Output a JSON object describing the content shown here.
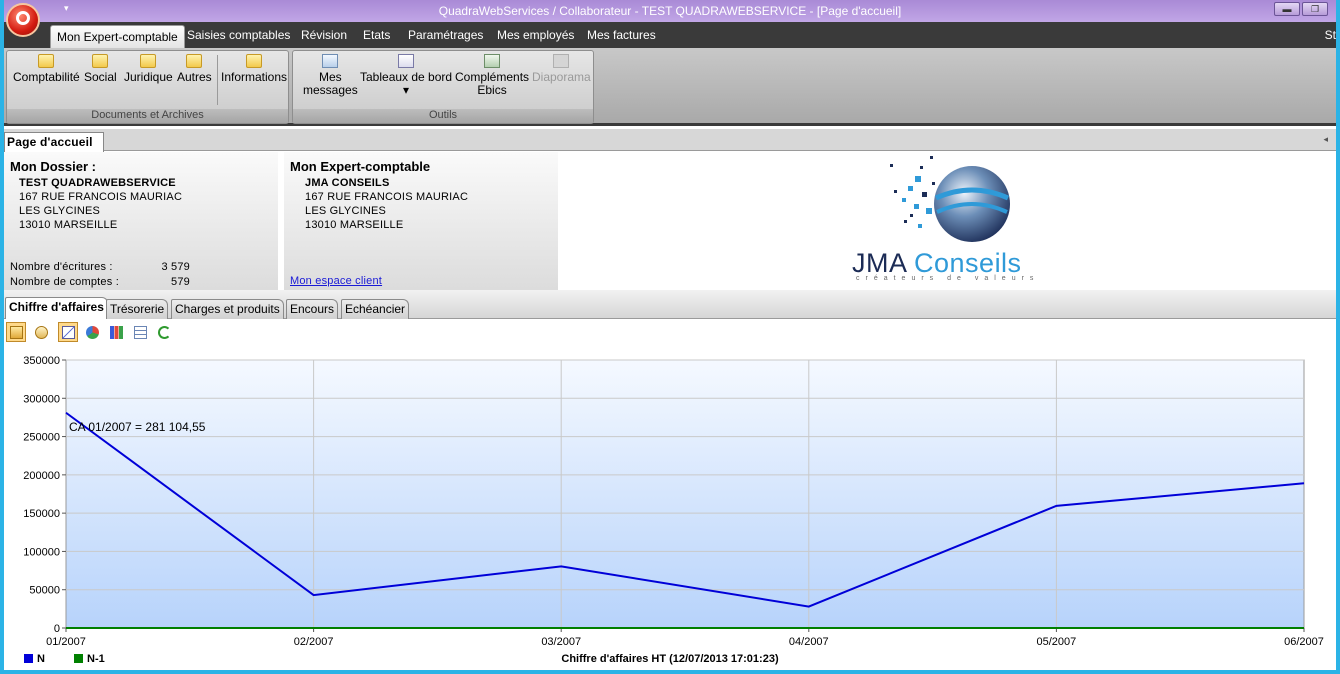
{
  "window": {
    "title": "QuadraWebServices / Collaborateur - TEST QUADRAWEBSERVICE - [Page d'accueil]",
    "minimize_label": "▬",
    "restore_label": "❐"
  },
  "qat_label": "▾",
  "menu": {
    "tabs": [
      "Mon Expert-comptable",
      "Saisies comptables",
      "Révision",
      "Etats",
      "Paramétrages",
      "Mes employés",
      "Mes factures"
    ],
    "active_index": 0,
    "overflow_label": "St"
  },
  "ribbon": {
    "documents_group": {
      "label": "Documents et Archives",
      "buttons": [
        "Comptabilité",
        "Social",
        "Juridique",
        "Autres",
        "Informations"
      ]
    },
    "outils_group": {
      "label": "Outils",
      "messages_line1": "Mes",
      "messages_line2": "messages",
      "tableaux_label": "Tableaux de bord",
      "tableaux_arrow": "▾",
      "complements_line1": "Compléments",
      "complements_line2": "Ebics",
      "diaporama_label": "Diaporama"
    }
  },
  "doc_tab": {
    "label": "Page d'accueil",
    "collapse_icon": "◂"
  },
  "mon_dossier": {
    "heading": "Mon Dossier :",
    "name": "TEST QUADRAWEBSERVICE",
    "address1": "167 RUE FRANCOIS MAURIAC",
    "address2": "LES GLYCINES",
    "city": "13010 MARSEILLE",
    "ecritures_label": "Nombre d'écritures :",
    "ecritures_value": "3 579",
    "comptes_label": "Nombre de comptes :",
    "comptes_value": "579"
  },
  "mon_expert": {
    "heading": "Mon Expert-comptable",
    "name": "JMA CONSEILS",
    "address1": "167 RUE FRANCOIS MAURIAC",
    "address2": "LES GLYCINES",
    "city": "13010 MARSEILLE",
    "link": "Mon espace client"
  },
  "logo": {
    "name_part1": "JMA ",
    "name_part2": "Conseils",
    "tagline": "créateurs de valeurs"
  },
  "sub_tabs": [
    "Chiffre d'affaires",
    "Trésorerie",
    "Charges et produits",
    "Encours",
    "Echéancier"
  ],
  "sub_tab_active": 0,
  "toolbar_icons": [
    "3d-chart-icon",
    "add-chart-icon",
    "line-chart-icon",
    "pie-chart-icon",
    "bar-chart-icon",
    "table-icon",
    "refresh-icon"
  ],
  "chart_data": {
    "type": "line",
    "x": [
      "01/2007",
      "02/2007",
      "03/2007",
      "04/2007",
      "05/2007",
      "06/2007"
    ],
    "series": [
      {
        "name": "N",
        "color": "#0000d8",
        "values": [
          281104.55,
          43000,
          80500,
          28000,
          159500,
          189000
        ]
      },
      {
        "name": "N-1",
        "color": "#008000",
        "values": [
          0,
          0,
          0,
          0,
          0,
          0
        ]
      }
    ],
    "ylim": [
      0,
      350000
    ],
    "yticks": [
      0,
      50000,
      100000,
      150000,
      200000,
      250000,
      300000,
      350000
    ],
    "grid": true,
    "annotation": "CA 01/2007 = 281 104,55",
    "caption": "Chiffre d'affaires HT (12/07/2013 17:01:23)",
    "legend_position": "bottom-left"
  },
  "colors": {
    "menubar": "#3a3a3a",
    "titlebar": "#b79be0",
    "frame": "#2bb3e6",
    "series_n": "#0000d8",
    "series_n1": "#008000"
  }
}
